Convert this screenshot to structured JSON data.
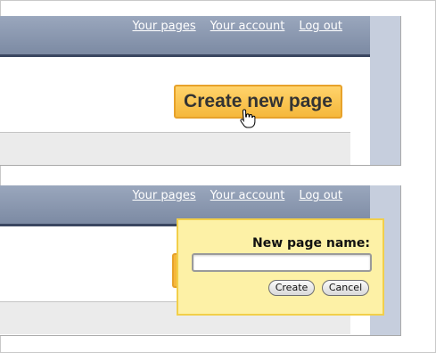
{
  "nav": {
    "your_pages": "Your pages",
    "your_account": "Your account",
    "log_out": "Log out"
  },
  "step1": {
    "create_button_label": "Create new page",
    "cursor_icon": "hand-pointer-icon"
  },
  "popup": {
    "label": "New page name:",
    "input_value": "",
    "create_label": "Create",
    "cancel_label": "Cancel"
  },
  "colors": {
    "header": "#7c8aa3",
    "header_border": "#3a4660",
    "accent_button": "#f5b83c",
    "popup_bg": "#fdf1a6",
    "popup_border": "#f2cf4a",
    "side_column": "#c6cedd",
    "footer_bar": "#ebebeb"
  }
}
